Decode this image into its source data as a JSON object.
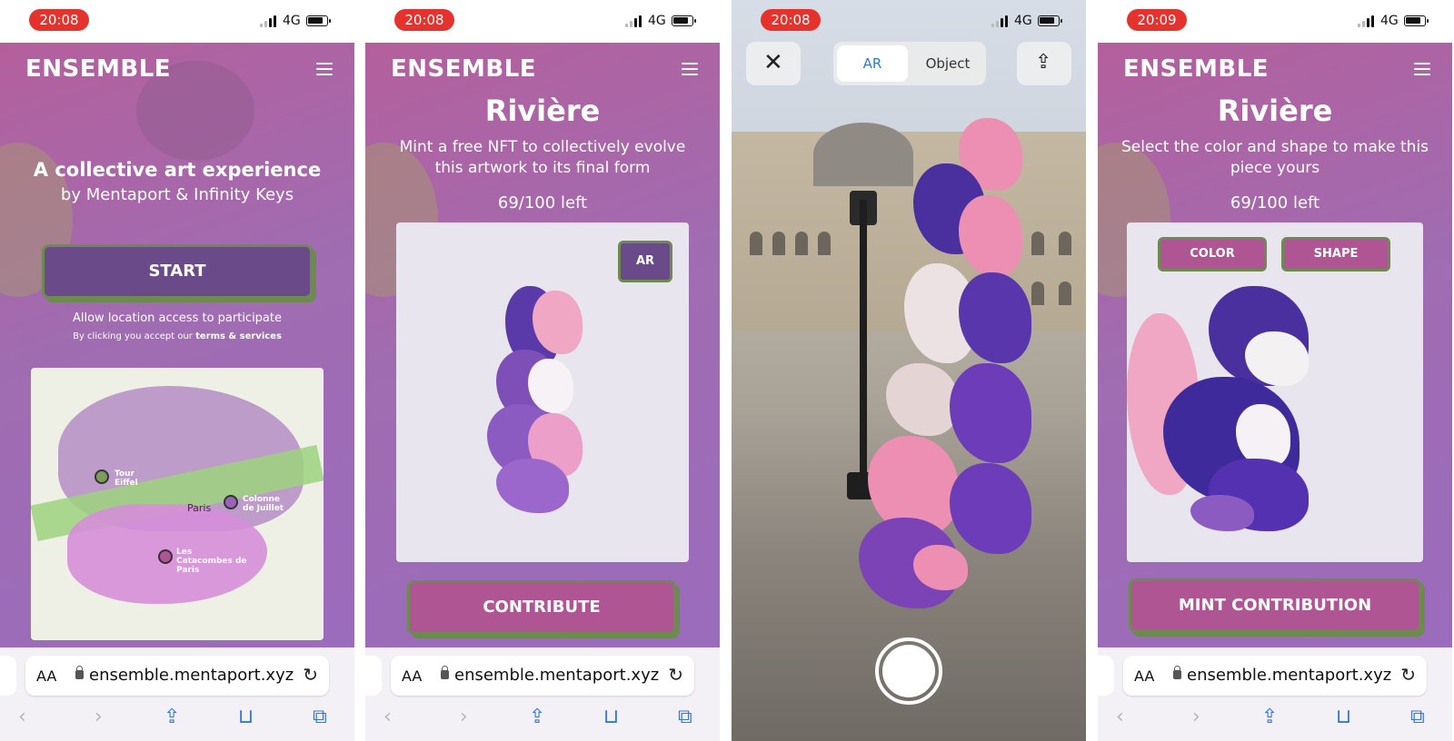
{
  "colors": {
    "pink_button": "#b05593",
    "purple_button": "#6b4a8a",
    "green_border": "#6d8a50",
    "safari_blue": "#2b78e4",
    "time_pill": "#e5322d"
  },
  "screens": [
    {
      "status": {
        "time": "20:08",
        "network": "4G"
      },
      "brand": "ENSEMBLE",
      "headline": "A collective art experience",
      "subheadline": "by Mentaport & Infinity Keys",
      "start_label": "START",
      "location_note": "Allow location access to participate",
      "terms_prefix": "By clicking you accept our",
      "terms_link": "terms & services",
      "map_pins": [
        "Tour Eiffel",
        "Colonne de Juillet",
        "Les Catacombes de Paris"
      ],
      "map_city": "Paris",
      "url": "ensemble.mentaport.xyz",
      "aa": "AA"
    },
    {
      "status": {
        "time": "20:08",
        "network": "4G"
      },
      "brand": "ENSEMBLE",
      "title": "Rivière",
      "subtitle": "Mint a free NFT to collectively evolve this artwork to its final form",
      "left_count": "69/100 left",
      "ar_label": "AR",
      "contribute_label": "CONTRIBUTE",
      "url": "ensemble.mentaport.xyz",
      "aa": "AA"
    },
    {
      "status": {
        "time": "20:08",
        "network": "4G"
      },
      "seg_ar": "AR",
      "seg_object": "Object"
    },
    {
      "status": {
        "time": "20:09",
        "network": "4G"
      },
      "brand": "ENSEMBLE",
      "title": "Rivière",
      "subtitle": "Select the color and shape to make this piece yours",
      "left_count": "69/100 left",
      "color_label": "COLOR",
      "shape_label": "SHAPE",
      "mint_label": "MINT CONTRIBUTION",
      "url": "ensemble.mentaport.xyz",
      "aa": "AA"
    }
  ]
}
